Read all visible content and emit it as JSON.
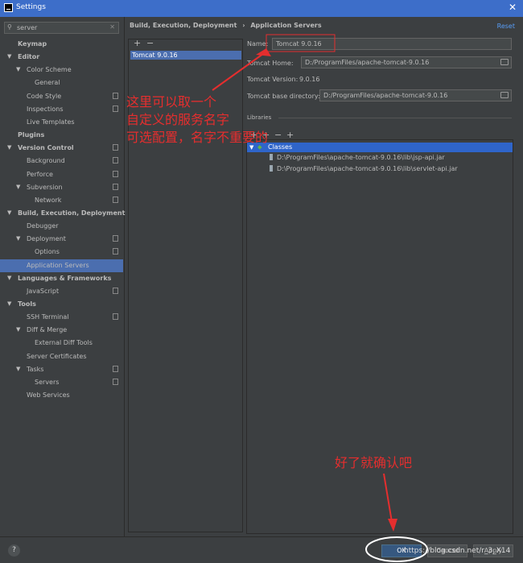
{
  "window": {
    "title": "Settings"
  },
  "search": {
    "value": "server"
  },
  "tree": [
    {
      "label": "Keymap",
      "bold": true,
      "level": 1,
      "arrow": "",
      "copy": false,
      "selected": false
    },
    {
      "label": "Editor",
      "bold": true,
      "level": 0,
      "arrow": "▼",
      "copy": false,
      "selected": false
    },
    {
      "label": "Color Scheme",
      "bold": false,
      "level": 1,
      "arrow": "▼",
      "copy": false,
      "selected": false
    },
    {
      "label": "General",
      "bold": false,
      "level": 3,
      "arrow": "",
      "copy": false,
      "selected": false
    },
    {
      "label": "Code Style",
      "bold": false,
      "level": 2,
      "arrow": "",
      "copy": true,
      "selected": false
    },
    {
      "label": "Inspections",
      "bold": false,
      "level": 2,
      "arrow": "",
      "copy": true,
      "selected": false
    },
    {
      "label": "Live Templates",
      "bold": false,
      "level": 2,
      "arrow": "",
      "copy": false,
      "selected": false
    },
    {
      "label": "Plugins",
      "bold": true,
      "level": 1,
      "arrow": "",
      "copy": false,
      "selected": false
    },
    {
      "label": "Version Control",
      "bold": true,
      "level": 0,
      "arrow": "▼",
      "copy": true,
      "selected": false
    },
    {
      "label": "Background",
      "bold": false,
      "level": 2,
      "arrow": "",
      "copy": true,
      "selected": false
    },
    {
      "label": "Perforce",
      "bold": false,
      "level": 2,
      "arrow": "",
      "copy": true,
      "selected": false
    },
    {
      "label": "Subversion",
      "bold": false,
      "level": 1,
      "arrow": "▼",
      "copy": true,
      "selected": false
    },
    {
      "label": "Network",
      "bold": false,
      "level": 3,
      "arrow": "",
      "copy": true,
      "selected": false
    },
    {
      "label": "Build, Execution, Deployment",
      "bold": true,
      "level": 0,
      "arrow": "▼",
      "copy": false,
      "selected": false
    },
    {
      "label": "Debugger",
      "bold": false,
      "level": 2,
      "arrow": "",
      "copy": false,
      "selected": false
    },
    {
      "label": "Deployment",
      "bold": false,
      "level": 1,
      "arrow": "▼",
      "copy": true,
      "selected": false
    },
    {
      "label": "Options",
      "bold": false,
      "level": 3,
      "arrow": "",
      "copy": true,
      "selected": false
    },
    {
      "label": "Application Servers",
      "bold": false,
      "level": 2,
      "arrow": "",
      "copy": false,
      "selected": true
    },
    {
      "label": "Languages & Frameworks",
      "bold": true,
      "level": 0,
      "arrow": "▼",
      "copy": false,
      "selected": false
    },
    {
      "label": "JavaScript",
      "bold": false,
      "level": 2,
      "arrow": "",
      "copy": true,
      "selected": false
    },
    {
      "label": "Tools",
      "bold": true,
      "level": 0,
      "arrow": "▼",
      "copy": false,
      "selected": false
    },
    {
      "label": "SSH Terminal",
      "bold": false,
      "level": 2,
      "arrow": "",
      "copy": true,
      "selected": false
    },
    {
      "label": "Diff & Merge",
      "bold": false,
      "level": 1,
      "arrow": "▼",
      "copy": false,
      "selected": false
    },
    {
      "label": "External Diff Tools",
      "bold": false,
      "level": 3,
      "arrow": "",
      "copy": false,
      "selected": false
    },
    {
      "label": "Server Certificates",
      "bold": false,
      "level": 2,
      "arrow": "",
      "copy": false,
      "selected": false
    },
    {
      "label": "Tasks",
      "bold": false,
      "level": 1,
      "arrow": "▼",
      "copy": true,
      "selected": false
    },
    {
      "label": "Servers",
      "bold": false,
      "level": 3,
      "arrow": "",
      "copy": true,
      "selected": false
    },
    {
      "label": "Web Services",
      "bold": false,
      "level": 2,
      "arrow": "",
      "copy": false,
      "selected": false
    }
  ],
  "breadcrumb": {
    "part1": "Build, Execution, Deployment",
    "sep": "›",
    "part2": "Application Servers"
  },
  "reset_label": "Reset",
  "servers": {
    "add": "+",
    "remove": "−",
    "items": [
      "Tomcat 9.0.16"
    ]
  },
  "form": {
    "name_label": "Name:",
    "name_value": "Tomcat 9.0.16",
    "home_label": "Tomcat Home:",
    "home_value": "D:/ProgramFiles/apache-tomcat-9.0.16",
    "version_label": "Tomcat Version:",
    "version_value": "9.0.16",
    "base_label": "Tomcat base directory:",
    "base_value": "D:/ProgramFiles/apache-tomcat-9.0.16"
  },
  "libraries": {
    "label": "Libraries",
    "toolbar": [
      "+",
      "+",
      "−",
      "+"
    ],
    "root": "Classes",
    "jars": [
      "D:\\ProgramFiles\\apache-tomcat-9.0.16\\lib\\jsp-api.jar",
      "D:\\ProgramFiles\\apache-tomcat-9.0.16\\lib\\servlet-api.jar"
    ]
  },
  "footer": {
    "help": "?",
    "ok": "OK",
    "cancel": "Cancel",
    "apply": "Apply"
  },
  "annotations": {
    "line1": "这里可以取一个",
    "line2": "自定义的服务名字",
    "line3": "可选配置，名字不重要的",
    "confirm": "好了就确认吧",
    "color": "#e52e2e"
  },
  "watermark": "https://blog.csdn.net/r_3_X14"
}
